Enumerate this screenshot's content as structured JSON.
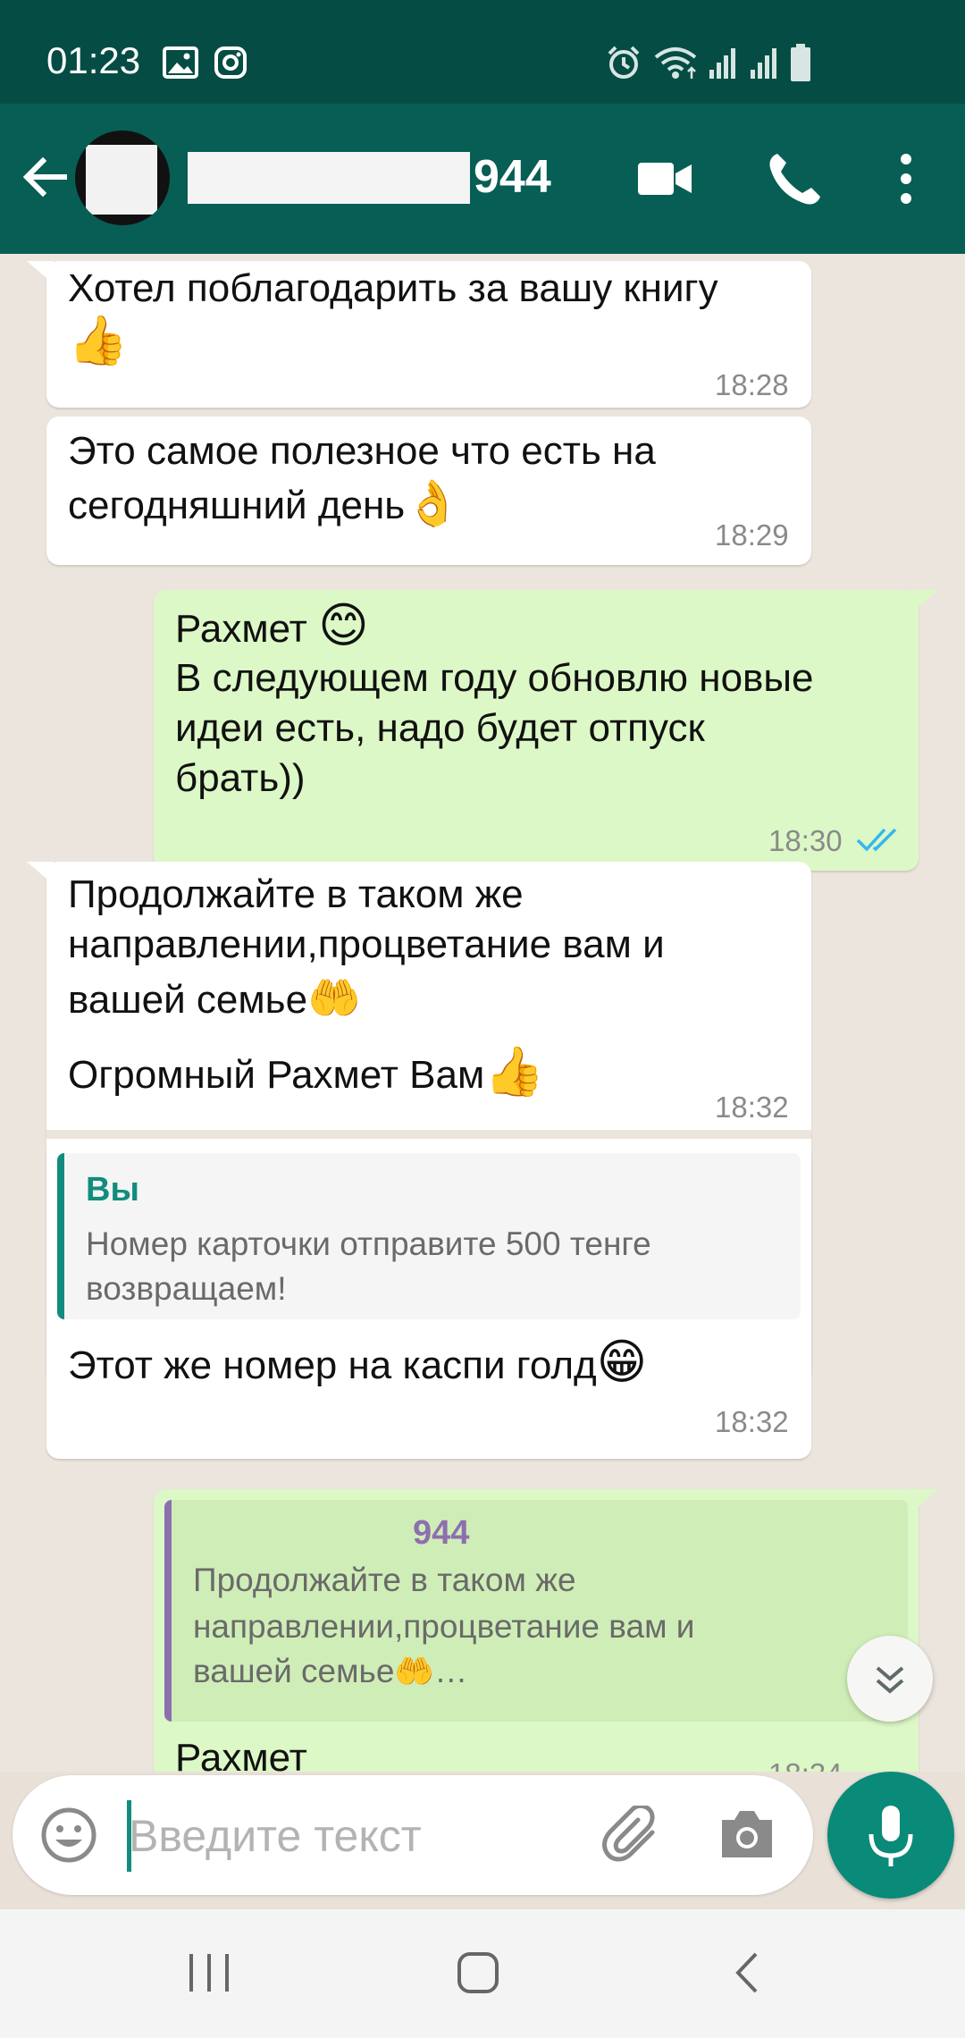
{
  "status_bar": {
    "time": "01:23",
    "icons": [
      "image-icon",
      "instagram-icon",
      "alarm-icon",
      "wifi-icon",
      "signal-icon",
      "signal-icon",
      "battery-icon"
    ]
  },
  "header": {
    "contact_name_suffix": "944",
    "icons": [
      "back-arrow-icon",
      "video-call-icon",
      "phone-icon",
      "more-vert-icon"
    ]
  },
  "messages": [
    {
      "direction": "in",
      "lines": [
        "Хотел поблагодарить за вашу книгу"
      ],
      "emoji": "👍",
      "time": "18:28"
    },
    {
      "direction": "in",
      "lines": [
        "Это самое полезное что есть на",
        "сегодняшний день"
      ],
      "emoji": "👌",
      "time": "18:29"
    },
    {
      "direction": "out",
      "lines": [
        "Рахмет",
        "В следующем году обновлю новые",
        "идеи есть, надо будет отпуск",
        "брать))"
      ],
      "emoji": "😊",
      "time": "18:30"
    },
    {
      "direction": "in",
      "lines": [
        "Продолжайте в таком же",
        "направлении,процветание вам и",
        "вашей семье",
        "Огромный Рахмет Вам"
      ],
      "emoji1": "🤲",
      "emoji2": "👍",
      "time": "18:32"
    },
    {
      "direction": "in",
      "quote_author": "Вы",
      "quote_lines": [
        "Номер карточки отправите 500 тенге",
        "возвращаем!"
      ],
      "lines": [
        "Этот же номер на каспи голд"
      ],
      "emoji": "😁",
      "time": "18:32"
    },
    {
      "direction": "out",
      "quote_author": "944",
      "quote_lines": [
        "Продолжайте в таком же",
        "направлении,процветание вам и",
        "вашей семье"
      ],
      "quote_emoji": "🤲",
      "quote_ellipsis": "…",
      "lines": [
        "Рахмет"
      ],
      "time": "18:34"
    }
  ],
  "input": {
    "placeholder": "Введите текст",
    "icons": [
      "emoji-icon",
      "attach-icon",
      "camera-icon",
      "mic-icon"
    ]
  },
  "colors": {
    "header": "#075e54",
    "status_bar": "#054d44",
    "outgoing": "#dcf8c6",
    "incoming": "#ffffff",
    "accent": "#0a8a78",
    "read_ticks": "#34b7f1"
  }
}
